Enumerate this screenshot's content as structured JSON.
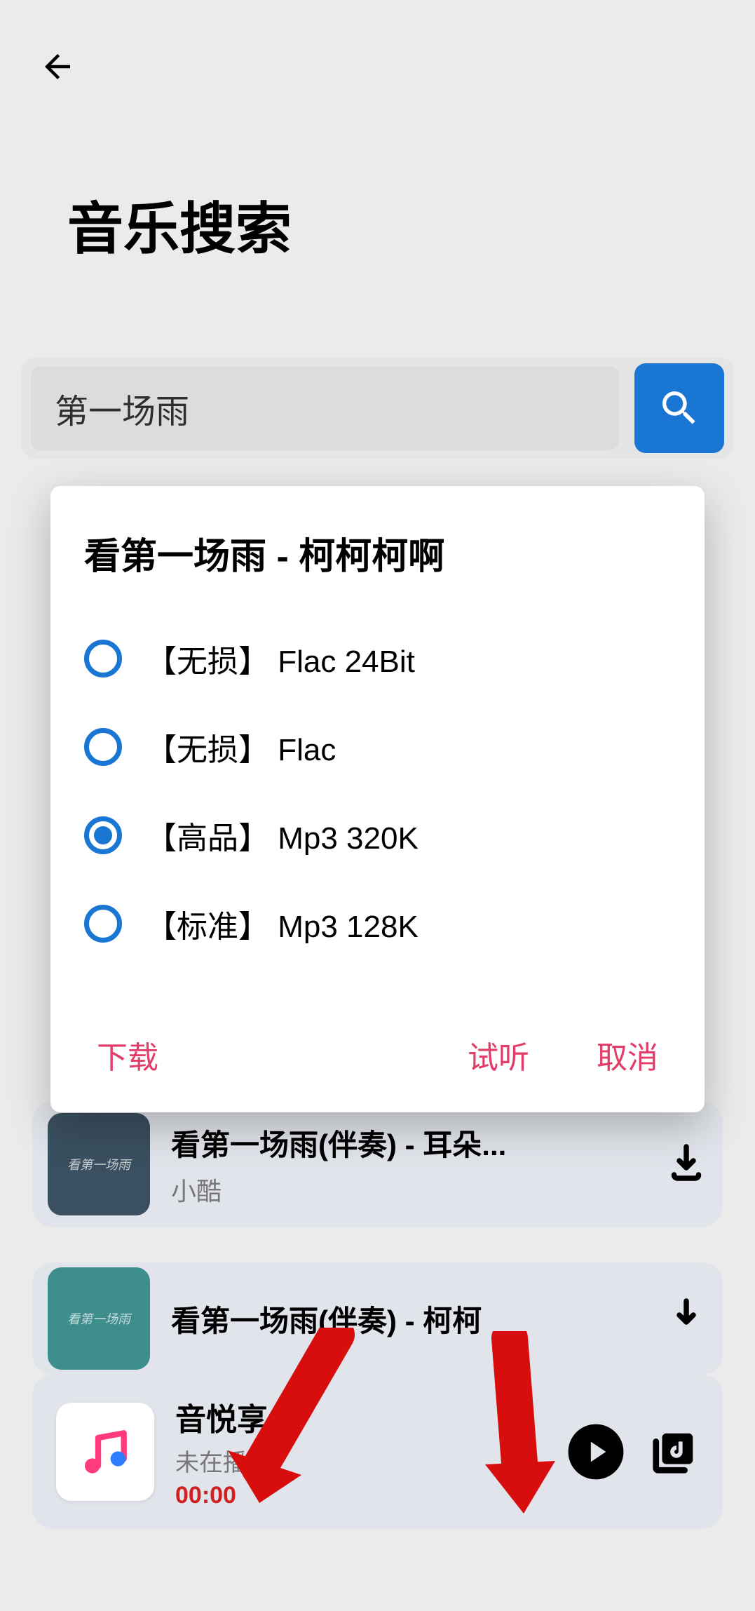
{
  "header": {
    "page_title": "音乐搜索"
  },
  "search": {
    "value": "第一场雨"
  },
  "modal": {
    "title": "看第一场雨 - 柯柯柯啊",
    "options": [
      {
        "label": "【无损】  Flac 24Bit",
        "selected": false
      },
      {
        "label": "【无损】  Flac",
        "selected": false
      },
      {
        "label": "【高品】  Mp3 320K",
        "selected": true
      },
      {
        "label": "【标准】  Mp3 128K",
        "selected": false
      }
    ],
    "download_label": "下载",
    "preview_label": "试听",
    "cancel_label": "取消"
  },
  "results": {
    "item4": {
      "title": "看第一场雨(伴奏) - 耳朵...",
      "sub": "小酷",
      "album_text": "看第一场雨"
    },
    "item5": {
      "title": "看第一场雨(伴奏) - 柯柯",
      "album_text": "看第一场雨"
    }
  },
  "player": {
    "title": "音悦享",
    "status": "未在播放",
    "time": "00:00"
  },
  "colors": {
    "accent_blue": "#1976d2",
    "accent_pink": "#e23c69",
    "time_red": "#d22020",
    "bg": "#ebebeb",
    "card": "#e1e4ea"
  }
}
